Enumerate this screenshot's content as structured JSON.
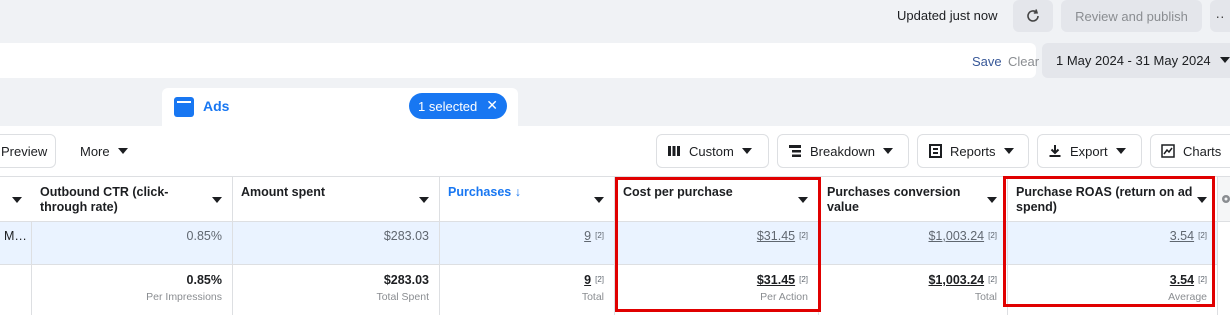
{
  "topbar": {
    "updated": "Updated just now",
    "publish": "Review and publish",
    "more": "··"
  },
  "filters": {
    "save": "Save",
    "clear": "Clear",
    "date_range": "1 May 2024 - 31 May 2024"
  },
  "tab": {
    "label": "Ads",
    "selected": "1 selected",
    "close": "✕"
  },
  "toolbar": {
    "preview": "Preview",
    "more": "More",
    "custom": "Custom",
    "breakdown": "Breakdown",
    "reports": "Reports",
    "export": "Export",
    "charts": "Charts"
  },
  "table": {
    "columns": [
      "Outbound CTR (click-through rate)",
      "Amount spent",
      "Purchases ↓",
      "Cost per purchase",
      "Purchases conversion value",
      "Purchase ROAS (return on ad spend)"
    ],
    "row_name": "M…",
    "row": [
      "0.85%",
      "$283.03",
      "9",
      "$31.45",
      "$1,003.24",
      "3.54"
    ],
    "totals": [
      "0.85%",
      "$283.03",
      "9",
      "$31.45",
      "$1,003.24",
      "3.54"
    ],
    "total_labels": [
      "Per Impressions",
      "Total Spent",
      "Total",
      "Per Action",
      "Total",
      "Average"
    ],
    "footnote": "[2]"
  },
  "colors": {
    "accent": "#1877f2",
    "highlight": "#e00000"
  }
}
